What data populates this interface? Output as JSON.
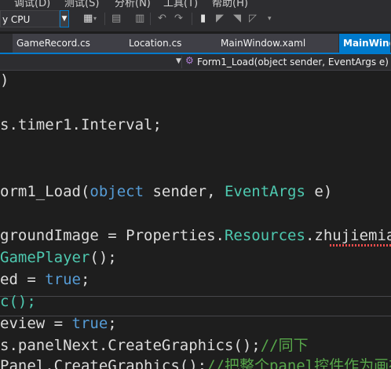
{
  "menubar": {
    "items": [
      "调试(D)",
      "测试(S)",
      "分析(N)",
      "工具(T)",
      "帮助(H)"
    ]
  },
  "toolbar": {
    "platform": "y CPU",
    "dropdown_icon": "chevron-down-icon",
    "buttons": [
      "debug-start-icon",
      "drop-arrow-icon",
      "comment-icon",
      "uncomment-icon",
      "undo-icon",
      "redo-icon",
      "bookmark-icon",
      "prev-bookmark-icon",
      "next-bookmark-icon",
      "clear-bookmarks-icon",
      "overflow-icon"
    ]
  },
  "tabs": [
    {
      "label": "GameRecord.cs",
      "active": false
    },
    {
      "label": "Location.cs",
      "active": false
    },
    {
      "label": "MainWindow.xaml",
      "active": false
    },
    {
      "label": "MainWindow.cs",
      "active": true
    }
  ],
  "navbar": {
    "member": "Form1_Load(object sender, EventArgs e)",
    "member_icon": "method-icon",
    "dropdown_icon": "chevron-down-icon"
  },
  "code": {
    "lines": [
      [
        {
          "t": ")",
          "c": "plain"
        }
      ],
      [],
      [
        {
          "t": "s.timer1.Interval;",
          "c": "plain"
        }
      ],
      [],
      [],
      [
        {
          "t": "orm1_Load(",
          "c": "plain"
        },
        {
          "t": "object",
          "c": "kw"
        },
        {
          "t": " sender, ",
          "c": "plain"
        },
        {
          "t": "EventArgs",
          "c": "type"
        },
        {
          "t": " e)",
          "c": "plain"
        }
      ],
      [],
      [
        {
          "t": "groundImage = Properties.",
          "c": "plain"
        },
        {
          "t": "Resources",
          "c": "type"
        },
        {
          "t": ".zhujiemian;",
          "c": "plain"
        }
      ],
      [
        {
          "t": "GamePlayer",
          "c": "type"
        },
        {
          "t": "();",
          "c": "plain"
        }
      ],
      [
        {
          "t": "ed = ",
          "c": "plain"
        },
        {
          "t": "true",
          "c": "kw"
        },
        {
          "t": ";",
          "c": "plain"
        }
      ],
      [
        {
          "t": "c();",
          "c": "type"
        }
      ],
      [
        {
          "t": "eview = ",
          "c": "plain"
        },
        {
          "t": "true",
          "c": "kw"
        },
        {
          "t": ";",
          "c": "plain"
        }
      ],
      [
        {
          "t": "s.panelNext.CreateGraphics();",
          "c": "plain"
        },
        {
          "t": "//同下",
          "c": "cmt"
        }
      ],
      [
        {
          "t": "Panel.CreateGraphics();",
          "c": "plain"
        },
        {
          "t": "//把整个panel控件作为画布",
          "c": "cmt"
        }
      ]
    ]
  },
  "colors": {
    "accent": "#007acc",
    "editor_bg": "#1e1e1e",
    "keyword": "#569cd6",
    "type": "#4ec9b0",
    "comment": "#57a64a",
    "error": "#f14c4c"
  }
}
